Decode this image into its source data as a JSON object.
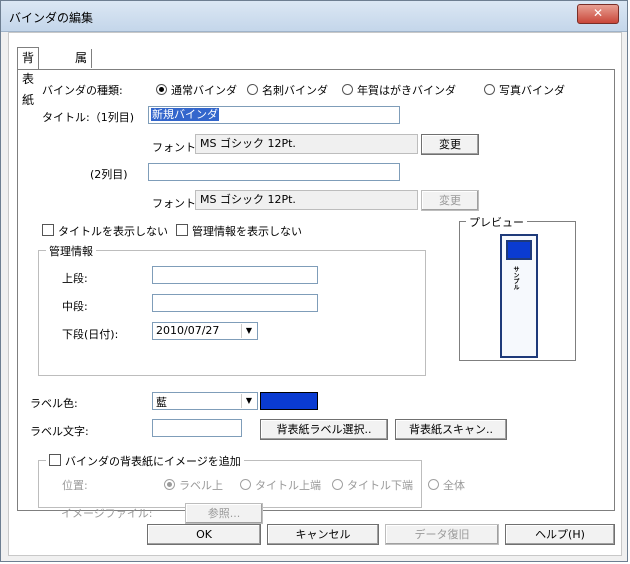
{
  "window": {
    "title": "バインダの編集",
    "close_label": "✕"
  },
  "tabs": [
    {
      "label": "背表紙",
      "active": true
    },
    {
      "label": "属性",
      "active": false
    }
  ],
  "binder_type": {
    "label": "バインダの種類:",
    "options": [
      {
        "label": "通常バインダ",
        "selected": true
      },
      {
        "label": "名刺バインダ",
        "selected": false
      },
      {
        "label": "年賀はがきバインダ",
        "selected": false
      },
      {
        "label": "写真バインダ",
        "selected": false
      }
    ]
  },
  "title1": {
    "label": "タイトル:（1列目)",
    "value": "新規バインダ",
    "font_label": "フォント:",
    "font_value": "MS ゴシック 12Pt.",
    "change_button": "変更"
  },
  "title2": {
    "label": "(2列目)",
    "value": "",
    "font_label": "フォント:",
    "font_value": "MS ゴシック 12Pt.",
    "change_button": "変更"
  },
  "checkboxes": {
    "hide_title": "タイトルを表示しない",
    "hide_management": "管理情報を表示しない"
  },
  "management": {
    "group_title": "管理情報",
    "upper_label": "上段:",
    "upper_value": "",
    "middle_label": "中段:",
    "middle_value": "",
    "lower_label": "下段(日付):",
    "lower_value": "2010/07/27"
  },
  "preview": {
    "title": "プレビュー",
    "spine_text": "サンプル"
  },
  "label_color": {
    "label": "ラベル色:",
    "value": "藍",
    "swatch_color": "#0a3bd1"
  },
  "label_text": {
    "label": "ラベル文字:",
    "value": "",
    "select_button": "背表紙ラベル選択..",
    "scan_button": "背表紙スキャン.."
  },
  "image_group": {
    "checkbox_label": "バインダの背表紙にイメージを追加",
    "position_label": "位置:",
    "positions": [
      {
        "label": "ラベル上",
        "selected": true
      },
      {
        "label": "タイトル上端",
        "selected": false
      },
      {
        "label": "タイトル下端",
        "selected": false
      },
      {
        "label": "全体",
        "selected": false
      }
    ],
    "file_label": "イメージファイル:",
    "browse_button": "参照..."
  },
  "footer": {
    "ok": "OK",
    "cancel": "キャンセル",
    "restore": "データ復旧",
    "help": "ヘルプ(H)"
  }
}
